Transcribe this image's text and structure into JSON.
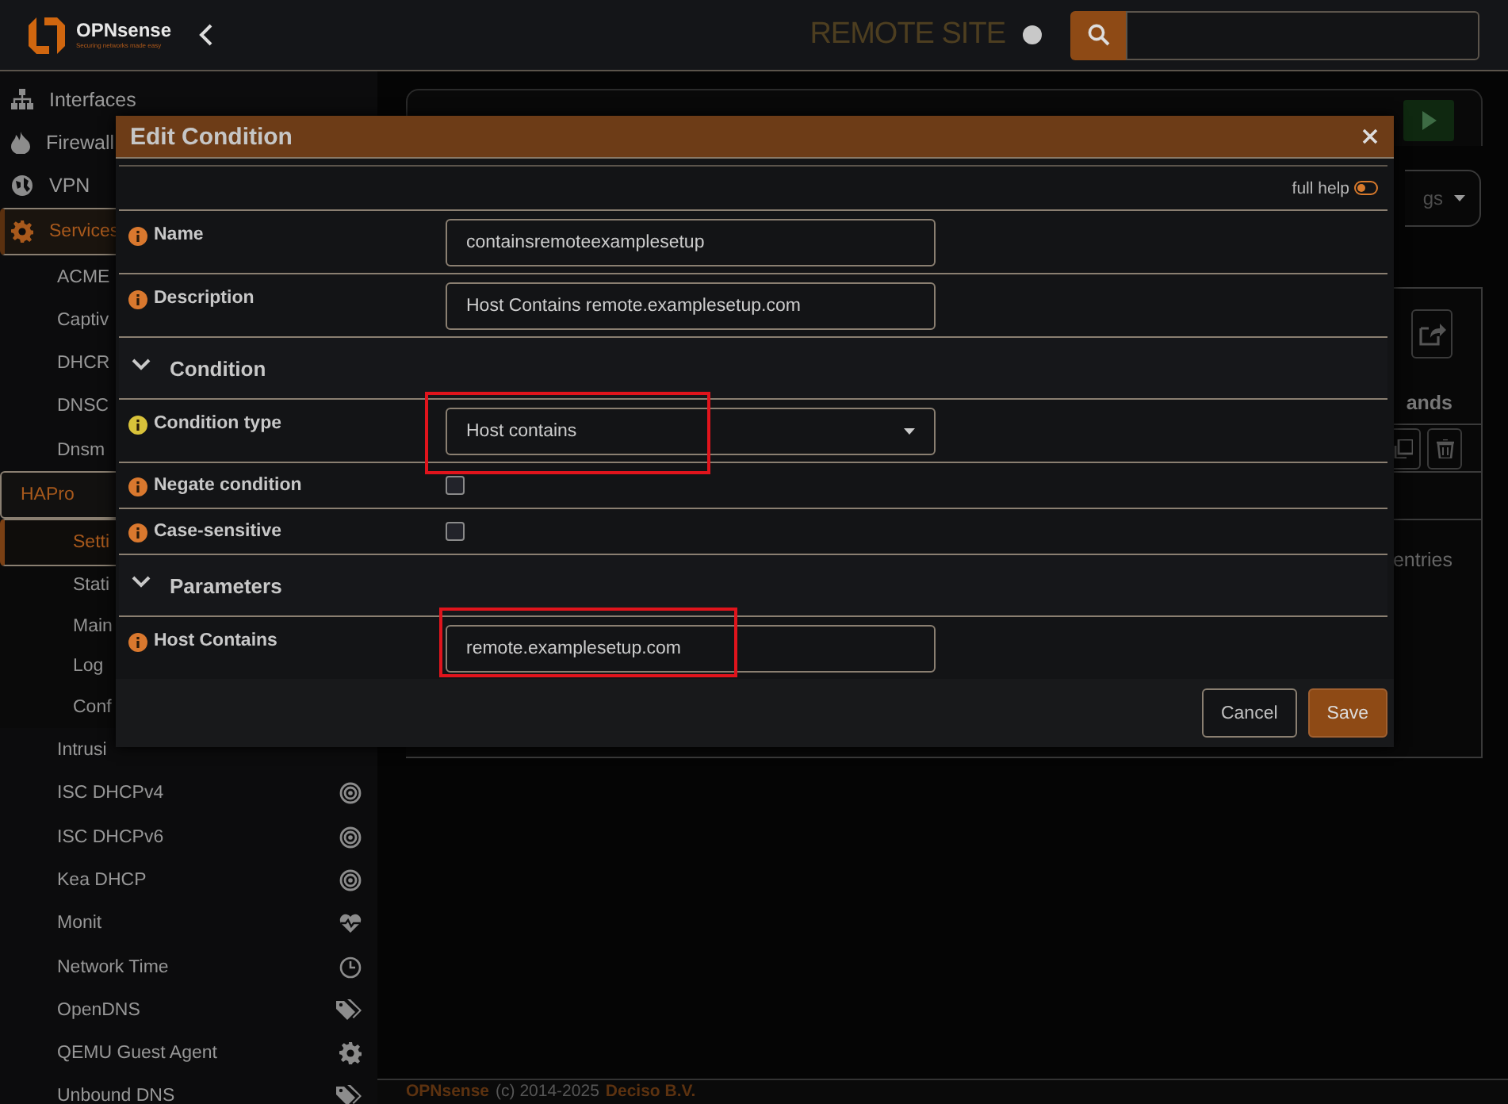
{
  "topbar": {
    "brand": "OPNsense",
    "tagline": "Securing networks made easy",
    "site_label": "REMOTE SITE"
  },
  "sidebar": {
    "items": [
      {
        "label": "Interfaces",
        "kind": "sitemap",
        "selected": false
      },
      {
        "label": "Firewall",
        "kind": "fire",
        "selected": false
      },
      {
        "label": "VPN",
        "kind": "globe",
        "selected": false
      },
      {
        "label": "Services",
        "kind": "gear",
        "selected": true,
        "expanded": true,
        "children": [
          {
            "label": "ACME",
            "selected": false
          },
          {
            "label": "Captiv",
            "selected": false
          },
          {
            "label": "DHCR",
            "selected": false
          },
          {
            "label": "DNSC",
            "selected": false
          },
          {
            "label": "Dnsm",
            "selected": false
          },
          {
            "label": "HAPro",
            "selected": true,
            "expanded": true,
            "children": [
              {
                "label": "Setti",
                "selected": true
              },
              {
                "label": "Stati",
                "selected": false
              },
              {
                "label": "Main",
                "selected": false
              },
              {
                "label": "Log",
                "selected": false
              },
              {
                "label": "Conf",
                "selected": false
              }
            ]
          },
          {
            "label": "Intrusi",
            "selected": false
          },
          {
            "label": "ISC DHCPv4",
            "kind": "target",
            "selected": false
          },
          {
            "label": "ISC DHCPv6",
            "kind": "target",
            "selected": false
          },
          {
            "label": "Kea DHCP",
            "kind": "target",
            "selected": false
          },
          {
            "label": "Monit",
            "kind": "heart",
            "selected": false
          },
          {
            "label": "Network Time",
            "kind": "clock",
            "selected": false
          },
          {
            "label": "OpenDNS",
            "kind": "tags",
            "selected": false
          },
          {
            "label": "QEMU Guest Agent",
            "kind": "gear",
            "selected": false
          },
          {
            "label": "Unbound DNS",
            "kind": "tags",
            "selected": false
          }
        ]
      }
    ]
  },
  "main": {
    "dropdown": {
      "label": "gs"
    },
    "table": {
      "columns": [
        "ands"
      ],
      "info": "entries"
    }
  },
  "modal": {
    "title": "Edit Condition",
    "full_help": {
      "label": "full help",
      "on": false
    },
    "fields": [
      {
        "kind": "text",
        "label": "Name",
        "value": "containsremoteexamplesetup",
        "color": "#d9782e",
        "highlighted": false
      },
      {
        "kind": "text",
        "label": "Description",
        "value": "Host Contains remote.examplesetup.com",
        "color": "#d9782e",
        "highlighted": false
      },
      {
        "kind": "section",
        "label": "Condition",
        "expanded": true
      },
      {
        "kind": "select",
        "label": "Condition type",
        "value": "Host contains",
        "color": "#d8c23a",
        "highlighted": true
      },
      {
        "kind": "checkbox",
        "label": "Negate condition",
        "checked": false,
        "color": "#d9782e",
        "highlighted": false
      },
      {
        "kind": "checkbox",
        "label": "Case-sensitive",
        "checked": false,
        "color": "#d9782e",
        "highlighted": false
      },
      {
        "kind": "section",
        "label": "Parameters",
        "expanded": true
      },
      {
        "kind": "text",
        "label": "Host Contains",
        "value": "remote.examplesetup.com",
        "color": "#d9782e",
        "highlighted": true
      }
    ],
    "buttons": [
      {
        "label": "Cancel",
        "kind": "default"
      },
      {
        "label": "Save",
        "kind": "primary"
      }
    ]
  },
  "footer": {
    "parts": [
      {
        "text": "OPNsense",
        "kind": "link"
      },
      {
        "text": "(c) 2014-2025",
        "kind": "plain"
      },
      {
        "text": "Deciso B.V.",
        "kind": "link"
      }
    ]
  }
}
